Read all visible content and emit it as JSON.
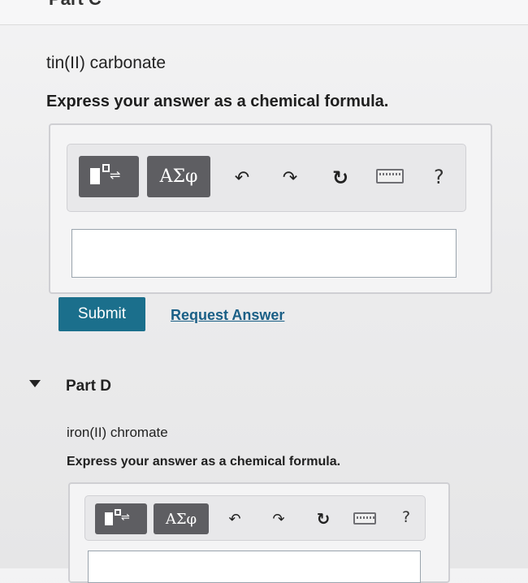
{
  "previous_part": {
    "title": "Part C"
  },
  "part_c": {
    "question": "tin(II) carbonate",
    "instruction": "Express your answer as a chemical formula.",
    "toolbar": {
      "templates_icon": "templates-icon",
      "greek_label": "ΑΣφ",
      "undo_icon": "undo-icon",
      "redo_icon": "redo-icon",
      "reset_icon": "reset-icon",
      "keyboard_icon": "keyboard-icon",
      "help_label": "?"
    },
    "answer": {
      "value": "",
      "placeholder": ""
    },
    "submit_label": "Submit",
    "request_answer_label": "Request Answer"
  },
  "part_d": {
    "title": "Part D",
    "question": "iron(II) chromate",
    "instruction": "Express your answer as a chemical formula.",
    "toolbar": {
      "templates_icon": "templates-icon",
      "greek_label": "ΑΣφ",
      "undo_icon": "undo-icon",
      "redo_icon": "redo-icon",
      "reset_icon": "reset-icon",
      "keyboard_icon": "keyboard-icon",
      "help_label": "?"
    },
    "answer": {
      "value": "",
      "placeholder": ""
    }
  },
  "colors": {
    "submit_bg": "#1b6f8c",
    "link": "#1a5f86",
    "tool_button_bg": "#5e5e62"
  }
}
